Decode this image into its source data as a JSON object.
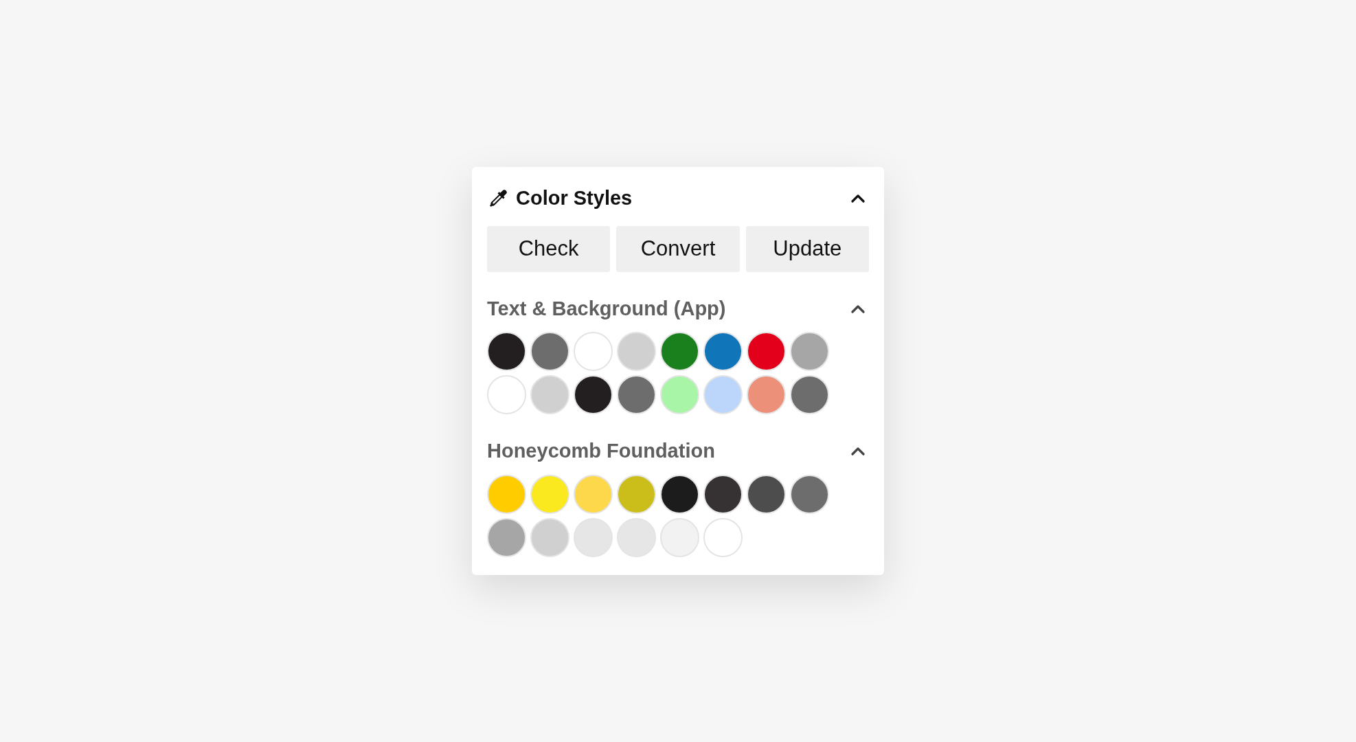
{
  "panel": {
    "title": "Color Styles",
    "expanded": true
  },
  "buttons": [
    "Check",
    "Convert",
    "Update"
  ],
  "sections": [
    {
      "title": "Text & Background (App)",
      "expanded": true,
      "swatches": [
        {
          "color": "#231f20"
        },
        {
          "color": "#6d6d6d"
        },
        {
          "color": "#ffffff"
        },
        {
          "color": "#d0d0d0"
        },
        {
          "color": "#1a801e"
        },
        {
          "color": "#1175b9"
        },
        {
          "color": "#e2001a"
        },
        {
          "color": "#a6a6a6"
        },
        {
          "color": "#ffffff"
        },
        {
          "color": "#d0d0d0"
        },
        {
          "color": "#231f20"
        },
        {
          "color": "#6d6d6d"
        },
        {
          "color": "#a8f5a8"
        },
        {
          "color": "#bcd6fb"
        },
        {
          "color": "#ec907a"
        },
        {
          "color": "#6d6d6d"
        }
      ]
    },
    {
      "title": "Honeycomb Foundation",
      "expanded": true,
      "swatches": [
        {
          "color": "#ffcc00"
        },
        {
          "color": "#fbe920"
        },
        {
          "color": "#fdd84a"
        },
        {
          "color": "#cbbe1a"
        },
        {
          "color": "#1c1c1c"
        },
        {
          "color": "#363233"
        },
        {
          "color": "#4d4d4d"
        },
        {
          "color": "#6d6d6d"
        },
        {
          "color": "#a6a6a6"
        },
        {
          "color": "#d0d0d0"
        },
        {
          "color": "#e6e6e6"
        },
        {
          "color": "#e6e6e6"
        },
        {
          "color": "#f2f2f2"
        },
        {
          "color": "#ffffff"
        }
      ]
    }
  ]
}
